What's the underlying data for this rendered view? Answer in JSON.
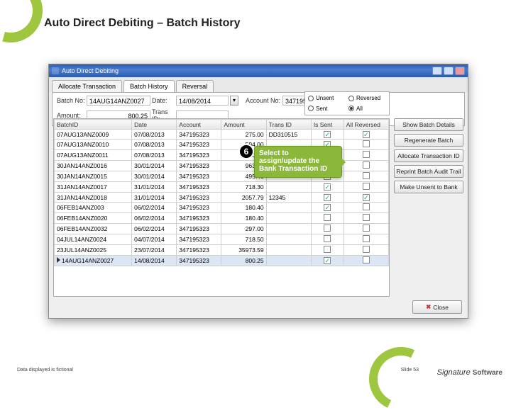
{
  "slide": {
    "title": "Auto Direct Debiting – Batch History",
    "footer_note": "Data displayed is fictional",
    "slide_num": "Slide 53",
    "logo_a": "Signature",
    "logo_b": "Software"
  },
  "window": {
    "title": "Auto Direct Debiting"
  },
  "tabs": [
    "Allocate Transaction",
    "Batch History",
    "Reversal"
  ],
  "filters": {
    "batch_no_label": "Batch No:",
    "batch_no": "14AUG14ANZ0027",
    "date_label": "Date:",
    "date": "14/08/2014",
    "account_no_label": "Account No:",
    "account_no": "347195323",
    "amount_label": "Amount:",
    "amount": "800.25",
    "trans_id_label": "Trans ID:",
    "trans_id": ""
  },
  "status": {
    "unsent": "Unsent",
    "reversed": "Reversed",
    "sent": "Sent",
    "all": "All"
  },
  "buttons": {
    "show": "Show Batch Details",
    "regen": "Regenerate Batch",
    "alloc": "Allocate Transaction ID",
    "reprint": "Reprint Batch Audit Trail",
    "unsent": "Make Unsent to Bank",
    "close": "Close"
  },
  "columns": [
    "BatchID",
    "Date",
    "Account",
    "Amount",
    "Trans ID",
    "Is Sent",
    "All Reversed"
  ],
  "rows": [
    {
      "b": "07AUG13ANZ0009",
      "d": "07/08/2013",
      "a": "347195323",
      "m": "275.00",
      "t": "DD310515",
      "s": true,
      "r": true
    },
    {
      "b": "07AUG13ANZ0010",
      "d": "07/08/2013",
      "a": "347195323",
      "m": "594.00",
      "t": "",
      "s": true,
      "r": false
    },
    {
      "b": "07AUG13ANZ0011",
      "d": "07/08/2013",
      "a": "347195323",
      "m": "90.00",
      "t": "",
      "s": true,
      "r": false
    },
    {
      "b": "30JAN14ANZ0016",
      "d": "30/01/2014",
      "a": "347195323",
      "m": "963.10",
      "t": "",
      "s": true,
      "r": false
    },
    {
      "b": "30JAN14ANZ0015",
      "d": "30/01/2014",
      "a": "347195323",
      "m": "495.46",
      "t": "",
      "s": true,
      "r": false
    },
    {
      "b": "31JAN14ANZ0017",
      "d": "31/01/2014",
      "a": "347195323",
      "m": "718.30",
      "t": "",
      "s": true,
      "r": false
    },
    {
      "b": "31JAN14ANZ0018",
      "d": "31/01/2014",
      "a": "347195323",
      "m": "2057.79",
      "t": "12345",
      "s": true,
      "r": true
    },
    {
      "b": "06FEB14ANZ003",
      "d": "06/02/2014",
      "a": "347195323",
      "m": "180.40",
      "t": "",
      "s": true,
      "r": false
    },
    {
      "b": "06FEB14ANZ0020",
      "d": "06/02/2014",
      "a": "347195323",
      "m": "180.40",
      "t": "",
      "s": false,
      "r": false
    },
    {
      "b": "06FEB14ANZ0032",
      "d": "06/02/2014",
      "a": "347195323",
      "m": "297.00",
      "t": "",
      "s": false,
      "r": false
    },
    {
      "b": "04JUL14ANZ0024",
      "d": "04/07/2014",
      "a": "347195323",
      "m": "718.50",
      "t": "",
      "s": false,
      "r": false
    },
    {
      "b": "23JUL14ANZ0025",
      "d": "23/07/2014",
      "a": "347195323",
      "m": "35973.59",
      "t": "",
      "s": false,
      "r": false
    },
    {
      "b": "14AUG14ANZ0027",
      "d": "14/08/2014",
      "a": "347195323",
      "m": "800.25",
      "t": "",
      "s": true,
      "r": false
    }
  ],
  "callout": {
    "step": "6",
    "text": "Select to assign/update the Bank Transaction ID"
  }
}
